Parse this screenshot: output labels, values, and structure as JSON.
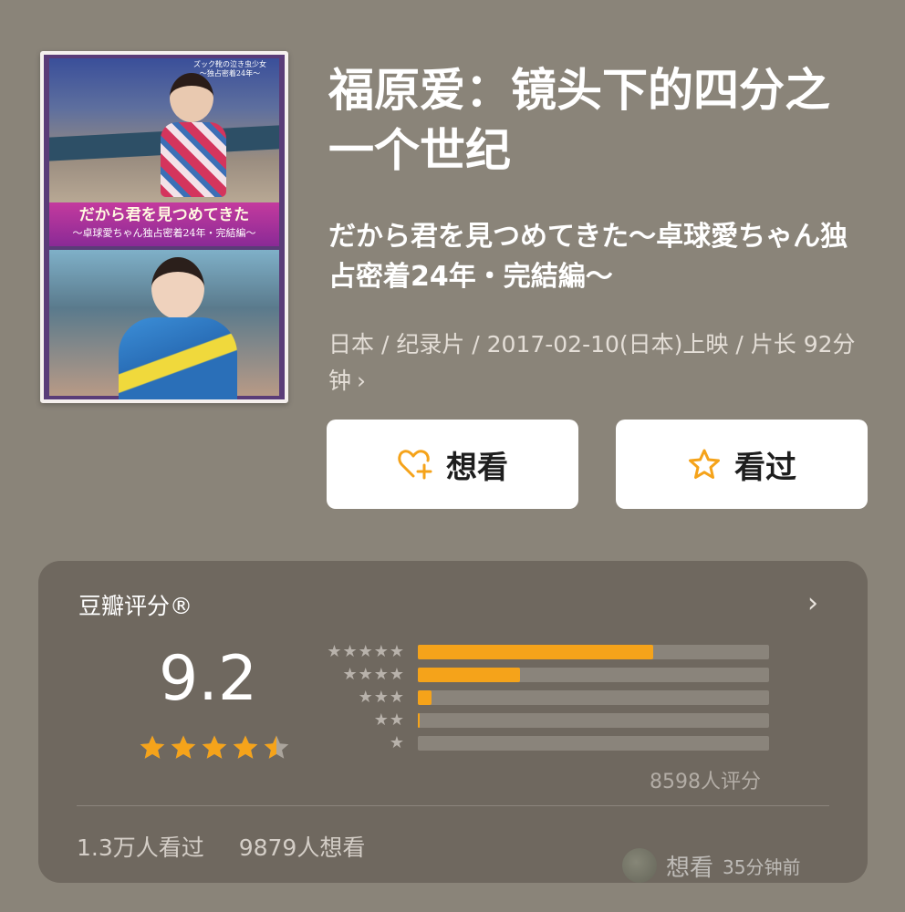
{
  "movie": {
    "title": "福原爱：镜头下的四分之一个世纪",
    "subtitle": "だから君を見つめてきた～卓球愛ちゃん独占密着24年・完結編～",
    "meta": "日本 / 纪录片 / 2017-02-10(日本)上映 / 片长 92分钟",
    "meta_chevron": "›"
  },
  "poster": {
    "tag_line1": "ズック靴の泣き虫少女",
    "tag_line2": "～独占密着24年～",
    "band_line1": "だから君を見つめてきた",
    "band_line2": "～卓球愛ちゃん独占密着24年・完結編～"
  },
  "actions": {
    "want_label": "想看",
    "want_icon": "heart-plus-icon",
    "seen_label": "看过",
    "seen_icon": "star-outline-icon",
    "accent_color": "#f5a31a"
  },
  "rating": {
    "label": "豆瓣评分®",
    "arrow": "›",
    "score": "9.2",
    "stars_value": 4.5,
    "distribution": [
      {
        "stars": "★★★★★",
        "percent": 67
      },
      {
        "stars": "★★★★",
        "percent": 29
      },
      {
        "stars": "★★★",
        "percent": 4
      },
      {
        "stars": "★★",
        "percent": 0.5
      },
      {
        "stars": "★",
        "percent": 0
      }
    ],
    "count": "8598人评分"
  },
  "footer": {
    "seen_count": "1.3万人看过",
    "want_count": "9879人想看"
  },
  "watermark": {
    "text": "想看",
    "time": "35分钟前"
  }
}
